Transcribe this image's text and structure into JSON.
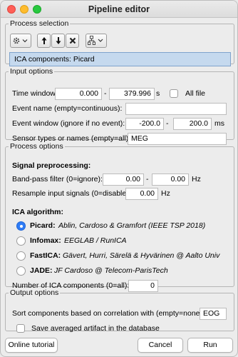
{
  "window": {
    "title": "Pipeline editor"
  },
  "process_selection": {
    "legend": "Process selection",
    "toolbar": [
      "gear-menu",
      "move-up",
      "move-down",
      "delete",
      "pipeline-menu"
    ],
    "selected_item": "ICA components: Picard"
  },
  "input_options": {
    "legend": "Input options",
    "time_window": {
      "label": "Time window:",
      "start": "0.000",
      "dash": "-",
      "end": "379.996",
      "unit": "s",
      "all_file_label": "All file"
    },
    "event_name": {
      "label": "Event name (empty=continuous):",
      "value": ""
    },
    "event_window": {
      "label": "Event window (ignore if no event):",
      "start": "-200.0",
      "dash": "-",
      "end": "200.0",
      "unit": "ms"
    },
    "sensor_types": {
      "label": "Sensor types or names (empty=all):",
      "value": "MEG"
    }
  },
  "process_options": {
    "legend": "Process options",
    "signal_preprocessing": "Signal preprocessing:",
    "bandpass": {
      "label": "Band-pass filter (0=ignore):",
      "low": "0.00",
      "dash": "-",
      "high": "0.00",
      "unit": "Hz"
    },
    "resample": {
      "label": "Resample input signals (0=disable):",
      "value": "0.00",
      "unit": "Hz"
    },
    "ica_algorithm": "ICA algorithm:",
    "algorithms": [
      {
        "name": "Picard:",
        "description": "Ablin, Cardoso & Gramfort (IEEE TSP 2018)"
      },
      {
        "name": "Infomax:",
        "description": "EEGLAB / RunICA"
      },
      {
        "name": "FastICA:",
        "description": "Gävert, Hurri, Särelä & Hyvärinen @ Aalto Univ"
      },
      {
        "name": "JADE:",
        "description": "JF Cardoso @ Telecom-ParisTech"
      }
    ],
    "num_components": {
      "label": "Number of ICA components (0=all):",
      "value": "0"
    }
  },
  "output_options": {
    "legend": "Output options",
    "sort_components": {
      "label": "Sort components based on correlation with (empty=none):",
      "value": "EOG"
    },
    "save_artifact_label": "Save averaged artifact in the database"
  },
  "footer": {
    "online_tutorial": "Online tutorial",
    "cancel": "Cancel",
    "run": "Run"
  },
  "colors": {
    "selection_bg": "#c5d9ee",
    "radio_selected": "#2f7cf6"
  }
}
